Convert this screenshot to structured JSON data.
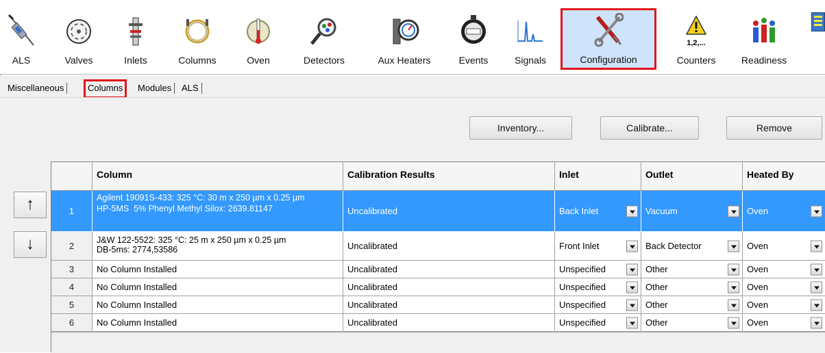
{
  "toolbar": {
    "items": [
      {
        "label": "ALS",
        "icon": "syringe-icon"
      },
      {
        "label": "Valves",
        "icon": "valve-icon"
      },
      {
        "label": "Inlets",
        "icon": "inlet-icon"
      },
      {
        "label": "Columns",
        "icon": "column-coil-icon"
      },
      {
        "label": "Oven",
        "icon": "oven-icon"
      },
      {
        "label": "Detectors",
        "icon": "detector-magnifier-icon"
      },
      {
        "label": "Aux Heaters",
        "icon": "aux-heater-gauge-icon"
      },
      {
        "label": "Events",
        "icon": "stopwatch-icon"
      },
      {
        "label": "Signals",
        "icon": "signal-peak-icon"
      },
      {
        "label": "Configuration",
        "icon": "screwdriver-wrench-icon"
      },
      {
        "label": "Counters",
        "icon": "warning-counter-icon",
        "icon_text": "1,2,..."
      },
      {
        "label": "Readiness",
        "icon": "readiness-people-icon"
      }
    ],
    "selected": "Configuration"
  },
  "tabs": [
    {
      "label": "Miscellaneous"
    },
    {
      "label": "Columns"
    },
    {
      "label": "Modules"
    },
    {
      "label": "ALS"
    }
  ],
  "active_tab": "Columns",
  "buttons": {
    "inventory": "Inventory...",
    "calibrate": "Calibrate...",
    "remove": "Remove"
  },
  "side_buttons": {
    "up": "↑",
    "down": "↓"
  },
  "table": {
    "headers": [
      "Column",
      "Calibration Results",
      "Inlet",
      "Outlet",
      "Heated By"
    ],
    "rows": [
      {
        "num": "1",
        "column": "Agilent 19091S-433: 325 °C: 30 m x 250 µm x 0.25 µm\nHP-5MS  5% Phenyl Methyl Silox: 2639.81147",
        "calibration": "Uncalibrated",
        "inlet": "Back Inlet",
        "outlet": "Vacuum",
        "heated_by": "Oven",
        "selected": true
      },
      {
        "num": "2",
        "column": "J&W 122-5522: 325 °C: 25 m x 250 µm x 0.25 µm\nDB-5ms: 2774,53586",
        "calibration": "Uncalibrated",
        "inlet": "Front Inlet",
        "outlet": "Back Detector",
        "heated_by": "Oven",
        "selected": false
      },
      {
        "num": "3",
        "column": "No Column Installed",
        "calibration": "Uncalibrated",
        "inlet": "Unspecified",
        "outlet": "Other",
        "heated_by": "Oven",
        "selected": false
      },
      {
        "num": "4",
        "column": "No Column Installed",
        "calibration": "Uncalibrated",
        "inlet": "Unspecified",
        "outlet": "Other",
        "heated_by": "Oven",
        "selected": false
      },
      {
        "num": "5",
        "column": "No Column Installed",
        "calibration": "Uncalibrated",
        "inlet": "Unspecified",
        "outlet": "Other",
        "heated_by": "Oven",
        "selected": false
      },
      {
        "num": "6",
        "column": "No Column Installed",
        "calibration": "Uncalibrated",
        "inlet": "Unspecified",
        "outlet": "Other",
        "heated_by": "Oven",
        "selected": false
      }
    ]
  },
  "colors": {
    "selection": "#3399ff",
    "highlight_border": "#e2141b",
    "selected_tool_bg": "#cfe3fb"
  }
}
